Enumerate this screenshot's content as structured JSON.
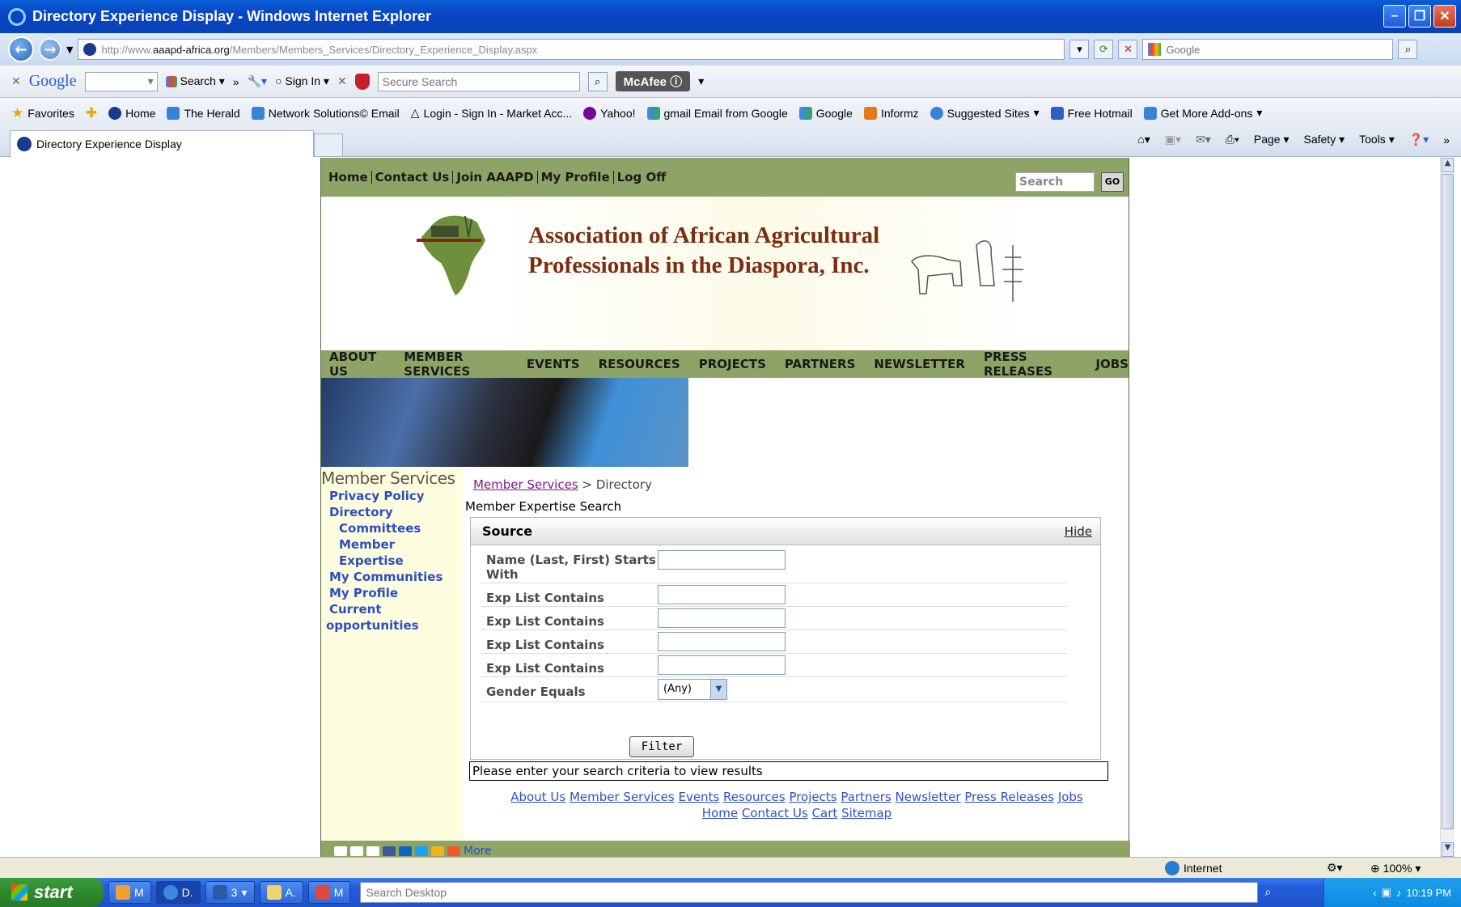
{
  "window": {
    "title": "Directory Experience Display - Windows Internet Explorer"
  },
  "address": {
    "url_prefix": "http://www.",
    "url_domain": "aaapd-africa.org",
    "url_path": "/Members/Members_Services/Directory_Experience_Display.aspx",
    "search_placeholder": "Google"
  },
  "google_toolbar": {
    "logo": "Google",
    "search_label": "Search",
    "sign_in": "Sign In",
    "secure_search": "Secure Search",
    "mcafee": "McAfee"
  },
  "favorites": {
    "label": "Favorites",
    "items": [
      "Home",
      "The Herald",
      "Network Solutions© Email",
      "Login - Sign In - Market Acc...",
      "Yahoo!",
      "gmail Email from Google",
      "Google",
      "Informz",
      "Suggested Sites",
      "Free Hotmail",
      "Get More Add-ons"
    ]
  },
  "tab": {
    "title": "Directory Experience Display"
  },
  "commands": {
    "page": "Page",
    "safety": "Safety",
    "tools": "Tools"
  },
  "site": {
    "topnav": [
      "Home",
      "Contact Us",
      "Join AAAPD",
      "My Profile",
      "Log Off"
    ],
    "search_placeholder": "Search",
    "go": "GO",
    "org_line1": "Association of African Agricultural",
    "org_line2": "Professionals in the Diaspora, Inc.",
    "mainnav": [
      "ABOUT US",
      "MEMBER SERVICES",
      "EVENTS",
      "RESOURCES",
      "PROJECTS",
      "PARTNERS",
      "NEWSLETTER",
      "PRESS RELEASES",
      "JOBS"
    ],
    "sidebar": {
      "heading": "Member Services",
      "links": [
        "Privacy Policy",
        "Directory",
        "Committees",
        "Member Expertise",
        "My Communities",
        "My Profile",
        "Current",
        "opportunities"
      ]
    },
    "breadcrumb": {
      "link": "Member Services",
      "sep": " > ",
      "current": "Directory"
    },
    "section_title": "Member Expertise Search",
    "panel": {
      "title": "Source",
      "hide": "Hide",
      "fields": [
        {
          "label": "Name (Last, First) Starts With",
          "value": ""
        },
        {
          "label": "Exp List Contains",
          "value": ""
        },
        {
          "label": "Exp List Contains",
          "value": ""
        },
        {
          "label": "Exp List Contains",
          "value": ""
        },
        {
          "label": "Exp List Contains",
          "value": ""
        }
      ],
      "gender_label": "Gender Equals",
      "gender_value": "(Any)",
      "filter_button": "Filter"
    },
    "message": "Please enter your search criteria to view results",
    "footer_links1": [
      "About Us",
      "Member Services",
      "Events",
      "Resources",
      "Projects",
      "Partners",
      "Newsletter",
      "Press Releases",
      "Jobs"
    ],
    "footer_links2": [
      "Home",
      "Contact Us",
      "Cart",
      "Sitemap"
    ],
    "share_more": "More"
  },
  "statusbar": {
    "zone": "Internet",
    "zoom": "100%"
  },
  "taskbar": {
    "start": "start",
    "items": [
      "M",
      "D.",
      "3",
      "A.",
      "M"
    ],
    "search_placeholder": "Search Desktop",
    "clock": "10:19 PM"
  },
  "colors": {
    "site_green": "#8ea467",
    "sidebar_bg": "#fffde0",
    "heading_brown": "#7a2d12",
    "link_blue": "#2a4fc0"
  }
}
